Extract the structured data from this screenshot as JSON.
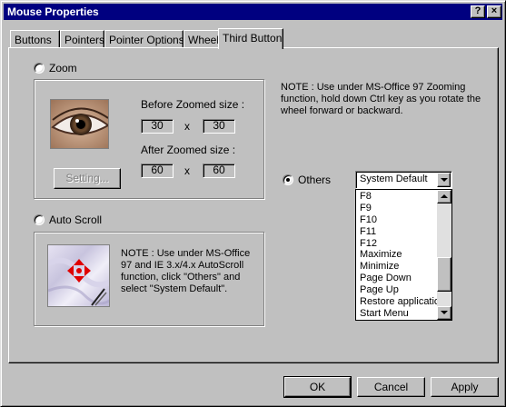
{
  "window": {
    "title": "Mouse Properties",
    "help_button": "?",
    "close_button": "×"
  },
  "tabs": [
    {
      "label": "Buttons"
    },
    {
      "label": "Pointers"
    },
    {
      "label": "Pointer Options"
    },
    {
      "label": "Wheel"
    },
    {
      "label": "Third Button",
      "active": true
    }
  ],
  "zoom": {
    "radio_label": "Zoom",
    "selected": false,
    "before_label": "Before Zoomed size :",
    "before_w": "30",
    "before_h": "30",
    "after_label": "After Zoomed size :",
    "after_w": "60",
    "after_h": "60",
    "times": "x",
    "setting_button": "Setting...",
    "note": "NOTE : Use under MS-Office 97 Zooming function, hold down Ctrl key as you rotate the wheel forward or backward."
  },
  "auto_scroll": {
    "radio_label": "Auto Scroll",
    "selected": false,
    "note": "NOTE : Use under MS-Office 97 and IE 3.x/4.x AutoScroll function, click \"Others\" and select \"System Default\"."
  },
  "others": {
    "radio_label": "Others",
    "selected": true,
    "combo_value": "System Default",
    "list_items": [
      "F8",
      "F9",
      "F10",
      "F11",
      "F12",
      "Maximize",
      "Minimize",
      "Page Down",
      "Page Up",
      "Restore application",
      "Start Menu"
    ]
  },
  "footer": {
    "ok": "OK",
    "cancel": "Cancel",
    "apply": "Apply"
  },
  "colors": {
    "titlebar": "#000080",
    "face": "#c0c0c0",
    "scroll_icon_red": "#e00000"
  },
  "icons": {
    "eye": "eye-image",
    "autoscroll": "autoscroll-image"
  }
}
